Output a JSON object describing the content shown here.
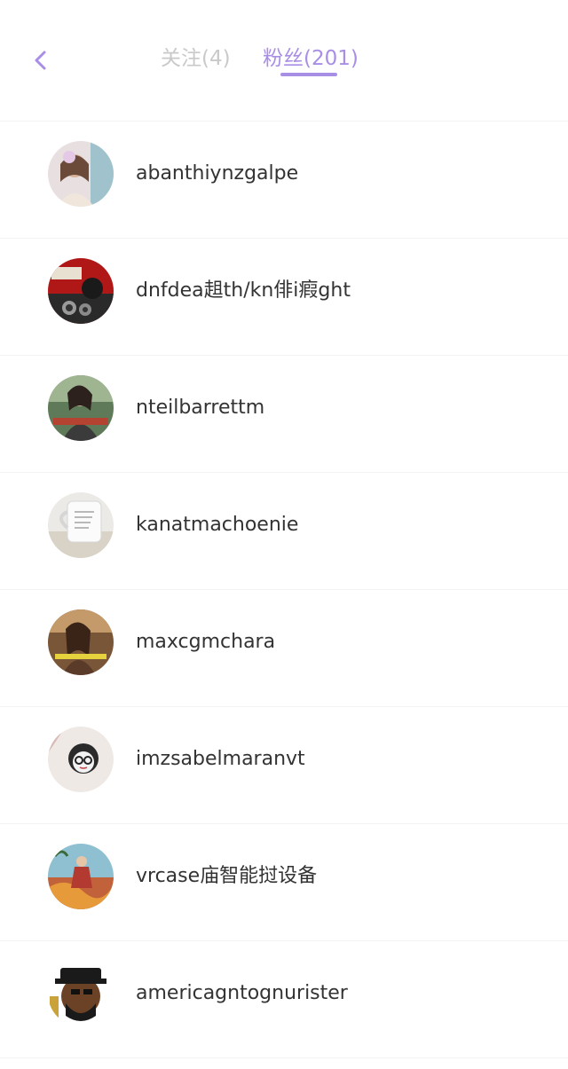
{
  "header": {
    "back_icon": "chevron-left-icon",
    "tabs": [
      {
        "label": "关注(4)",
        "active": false
      },
      {
        "label": "粉丝(201)",
        "active": true
      }
    ]
  },
  "colors": {
    "accent": "#a98ee6",
    "inactive_tab": "#c9c9c9",
    "text": "#333333",
    "divider": "#f3f3f3"
  },
  "followers": [
    {
      "username": "abanthiynzgalpe"
    },
    {
      "username": "dnfdea趄th/kn俳i瘕ght"
    },
    {
      "username": "nteilbarrettm"
    },
    {
      "username": "kanatmachoenie"
    },
    {
      "username": "maxcgmchara"
    },
    {
      "username": "imzsabelmaranvt"
    },
    {
      "username": "vrcase庙智能挝设备"
    },
    {
      "username": "americagntognurister"
    }
  ]
}
